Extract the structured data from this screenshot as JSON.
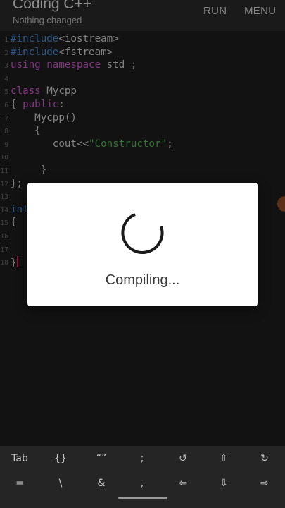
{
  "app": {
    "title": "Coding C++",
    "subtitle": "Nothing changed",
    "run_label": "RUN",
    "menu_label": "MENU"
  },
  "editor": {
    "line_numbers": [
      "1",
      "2",
      "3",
      "4",
      "5",
      "6",
      "7",
      "8",
      "9",
      "10",
      "11",
      "12",
      "13",
      "14",
      "15",
      "16",
      "17",
      "18"
    ],
    "lines": [
      [
        {
          "t": "#include",
          "c": "k1"
        },
        {
          "t": "<iostream>",
          "c": ""
        }
      ],
      [
        {
          "t": "#include",
          "c": "k1"
        },
        {
          "t": "<fstream>",
          "c": ""
        }
      ],
      [
        {
          "t": "using",
          "c": "k2"
        },
        {
          "t": " ",
          "c": ""
        },
        {
          "t": "namespace",
          "c": "k2"
        },
        {
          "t": " std ;",
          "c": ""
        }
      ],
      [],
      [
        {
          "t": "class",
          "c": "k2"
        },
        {
          "t": " Mycpp",
          "c": ""
        }
      ],
      [
        {
          "t": "{ ",
          "c": ""
        },
        {
          "t": "public",
          "c": "k2"
        },
        {
          "t": ":",
          "c": ""
        }
      ],
      [
        {
          "t": "    Mycpp()",
          "c": ""
        }
      ],
      [
        {
          "t": "    {",
          "c": ""
        }
      ],
      [
        {
          "t": "       cout<<",
          "c": ""
        },
        {
          "t": "\"Constructor\"",
          "c": "str"
        },
        {
          "t": ";",
          "c": ""
        }
      ],
      [],
      [
        {
          "t": "     }",
          "c": ""
        }
      ],
      [
        {
          "t": "};",
          "c": ""
        }
      ],
      [],
      [
        {
          "t": "int",
          "c": "k1"
        }
      ],
      [
        {
          "t": "{",
          "c": ""
        }
      ],
      [],
      [],
      [
        {
          "t": "}",
          "c": ""
        }
      ]
    ]
  },
  "dialog": {
    "message": "Compiling..."
  },
  "keyboard": {
    "row1": [
      "Tab",
      "{}",
      "“”",
      ";",
      "↺",
      "⇧",
      "↻"
    ],
    "row2": [
      "=",
      "\\",
      "&",
      ",",
      "⇦",
      "⇩",
      "⇨"
    ]
  },
  "colors": {
    "keyword_blue": "#4e8fd8",
    "keyword_magenta": "#d05ad0",
    "string_green": "#5db85d",
    "cursor": "#e0245e"
  }
}
